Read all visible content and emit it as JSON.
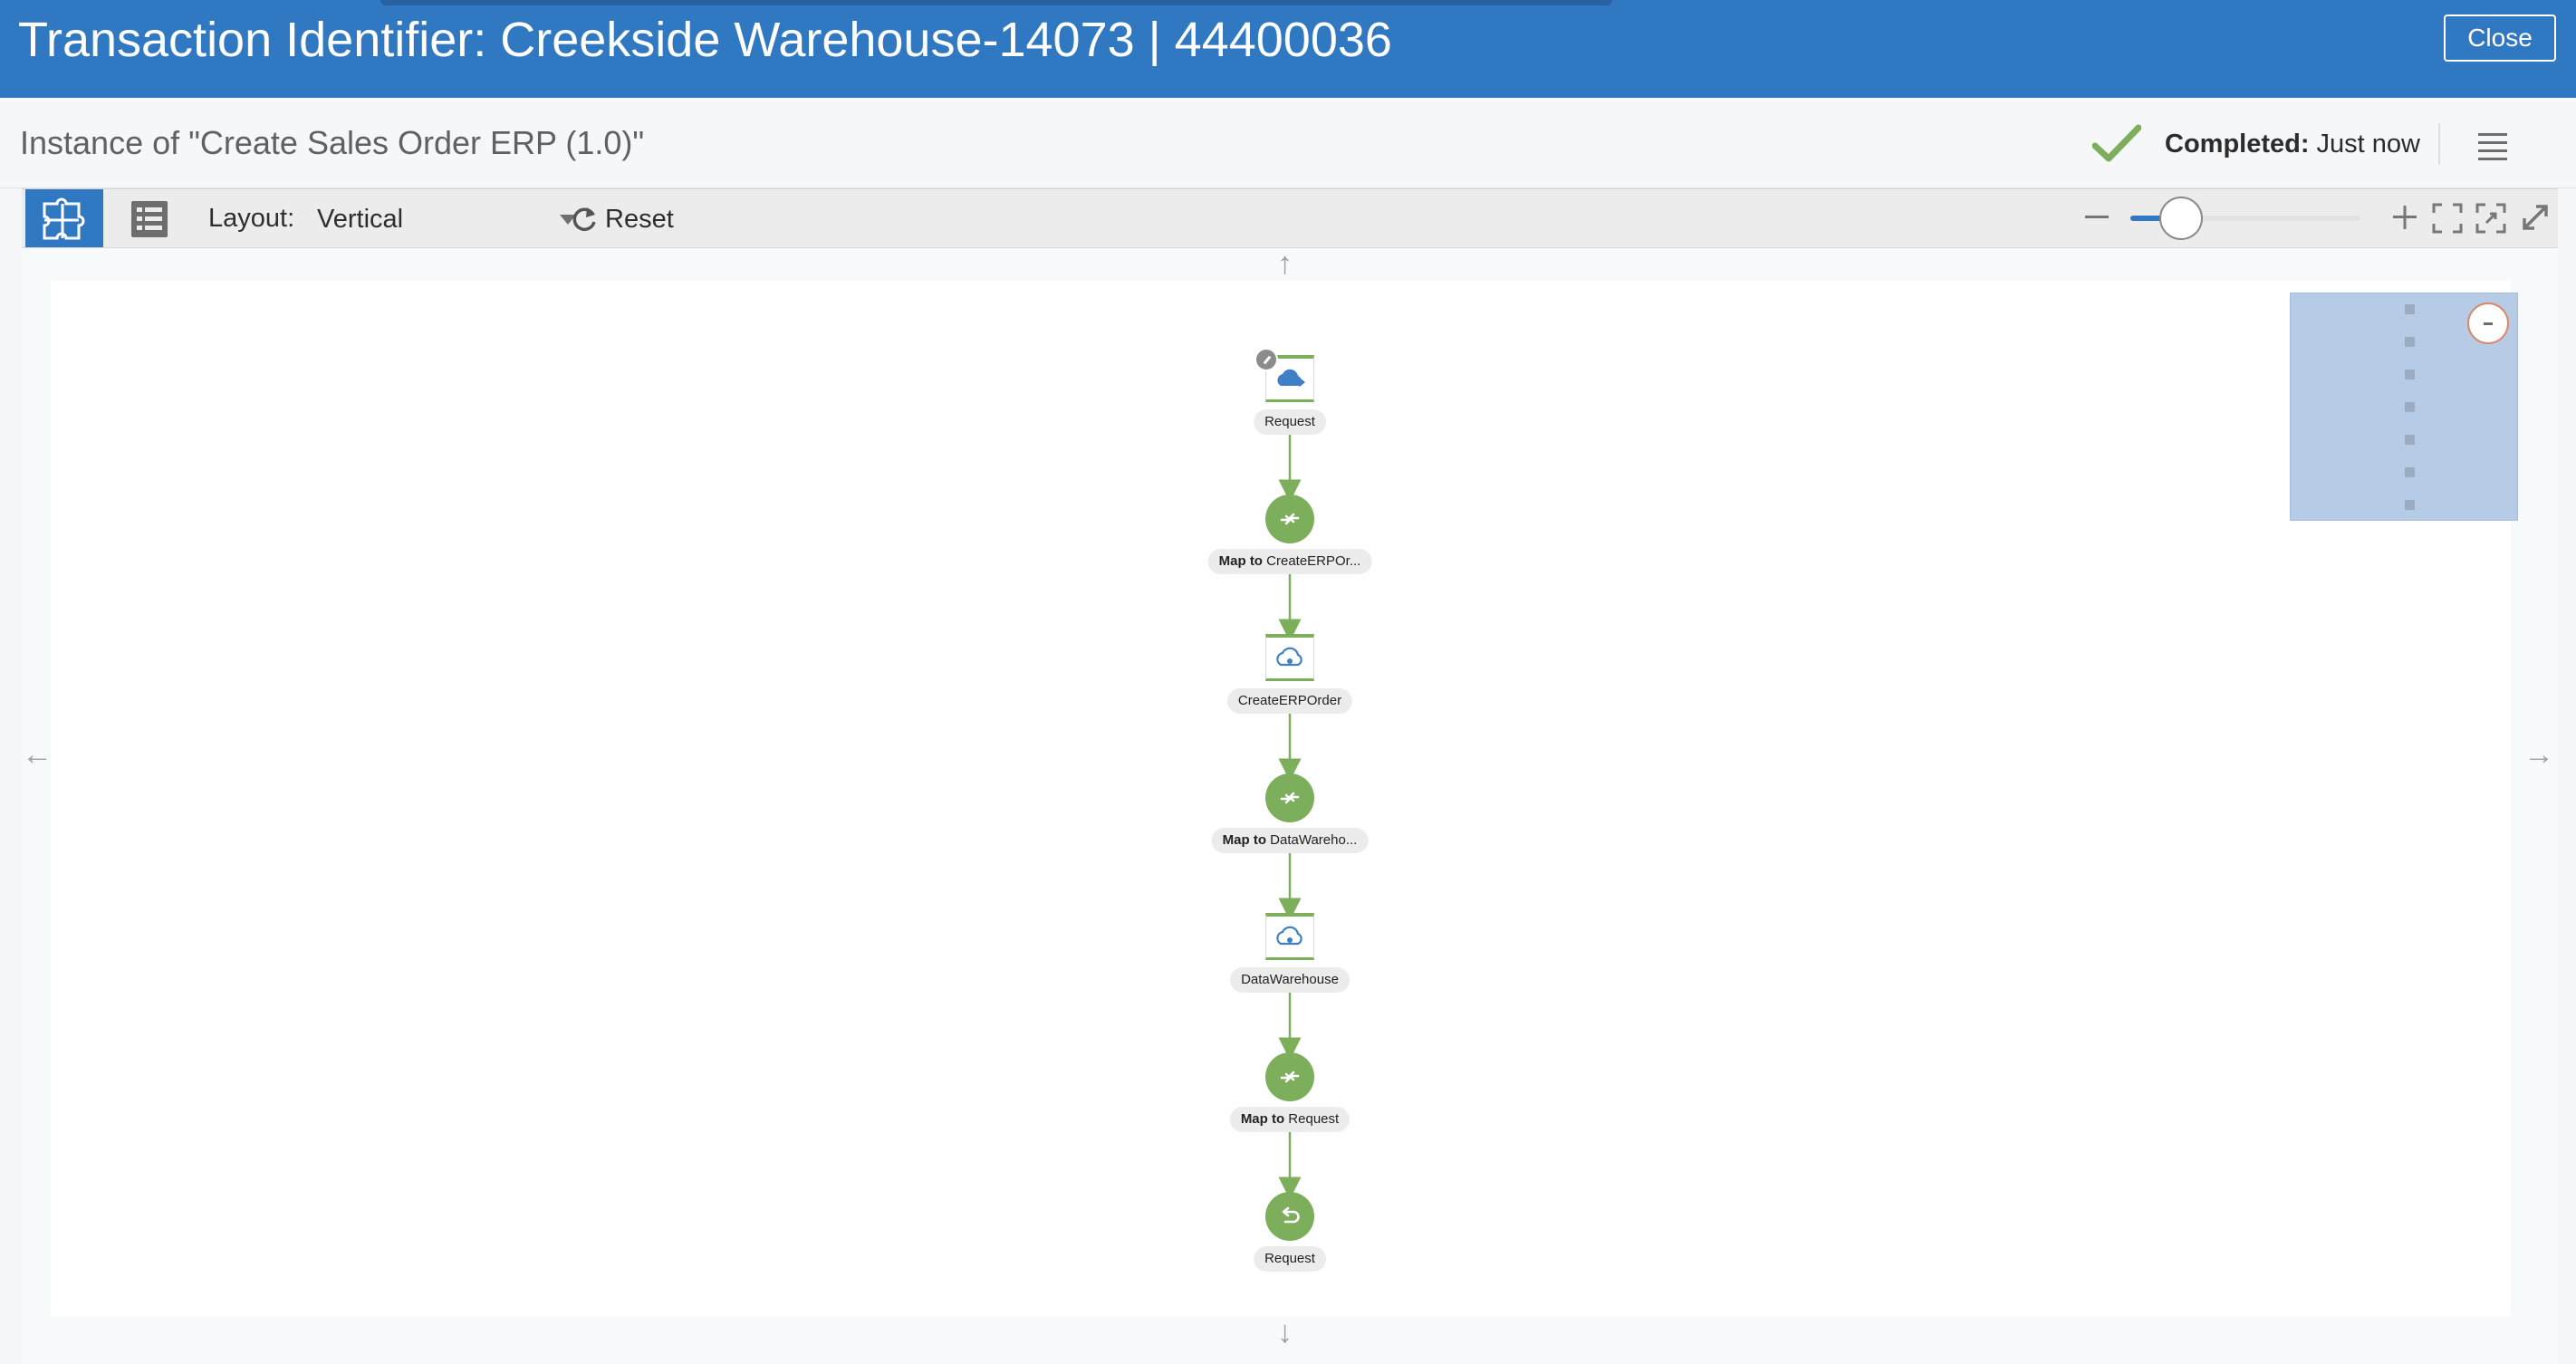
{
  "header": {
    "title": "Transaction Identifier: Creekside Warehouse-14073 | 44400036",
    "close_label": "Close"
  },
  "subheader": {
    "instance_text": "Instance of \"Create Sales Order ERP (1.0)\"",
    "status_label": "Completed:",
    "status_value": "Just now"
  },
  "toolbar": {
    "layout_label": "Layout:",
    "layout_value": "Vertical",
    "reset_label": "Reset",
    "zoom_level": 0.22
  },
  "flow": {
    "nodes": [
      {
        "type": "trigger",
        "icon": "rest-trigger-icon",
        "label_bold": "",
        "label": "Request"
      },
      {
        "type": "map",
        "icon": "map-icon",
        "label_bold": "Map to",
        "label": " CreateERPOr..."
      },
      {
        "type": "invoke",
        "icon": "cloud-invoke-icon",
        "label_bold": "",
        "label": "CreateERPOrder"
      },
      {
        "type": "map",
        "icon": "map-icon",
        "label_bold": "Map to",
        "label": " DataWareho..."
      },
      {
        "type": "invoke",
        "icon": "cloud-invoke-icon",
        "label_bold": "",
        "label": "DataWarehouse"
      },
      {
        "type": "map",
        "icon": "map-icon",
        "label_bold": "Map to",
        "label": " Request"
      },
      {
        "type": "return",
        "icon": "return-icon",
        "label_bold": "",
        "label": "Request"
      }
    ]
  },
  "colors": {
    "header": "#3178c2",
    "accent": "#3178c2",
    "flow_green": "#7cae5c",
    "status_check": "#7cae5c"
  }
}
